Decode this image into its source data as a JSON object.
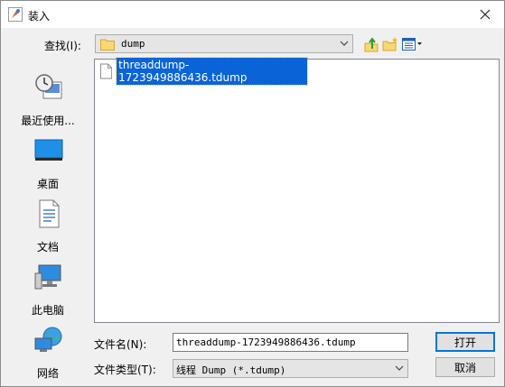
{
  "window": {
    "title": "装入"
  },
  "lookin": {
    "label": "查找(I):",
    "value": "dump",
    "toolbar": [
      {
        "name": "up-one-level-icon"
      },
      {
        "name": "new-folder-icon"
      },
      {
        "name": "view-menu-icon"
      }
    ]
  },
  "places": [
    {
      "label": "最近使用...",
      "icon": "recent-items-icon"
    },
    {
      "label": "桌面",
      "icon": "desktop-icon"
    },
    {
      "label": "文档",
      "icon": "documents-icon"
    },
    {
      "label": "此电脑",
      "icon": "this-pc-icon"
    },
    {
      "label": "网络",
      "icon": "network-icon"
    }
  ],
  "files": [
    {
      "name": "threaddump-1723949886436.tdump",
      "selected": true
    }
  ],
  "filename": {
    "label": "文件名(N):",
    "value": "threaddump-1723949886436.tdump"
  },
  "filetype": {
    "label": "文件类型(T):",
    "value": "线程 Dump (*.tdump)"
  },
  "buttons": {
    "open": "打开",
    "cancel": "取消"
  },
  "colors": {
    "selection": "#0a64d7",
    "accent": "#0078d7"
  }
}
